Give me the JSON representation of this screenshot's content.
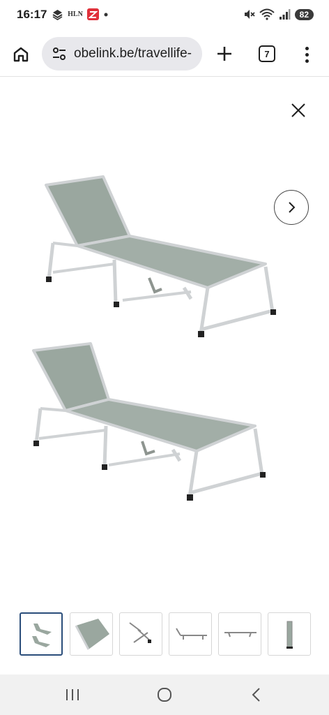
{
  "status_bar": {
    "time": "16:17",
    "notification_icons": [
      "stack-app-icon",
      "hln-icon",
      "zalando-icon",
      "dot-icon"
    ],
    "hln_label": "HLN",
    "system_icons": [
      "mute-icon",
      "wifi-icon",
      "signal-icon"
    ],
    "battery": "82"
  },
  "browser": {
    "url": "obelink.be/travellife-",
    "tab_count": "7"
  },
  "gallery": {
    "image_alt": "two-sun-loungers",
    "active_thumbnail_index": 0,
    "thumbnails": [
      {
        "subject": "two loungers"
      },
      {
        "subject": "fabric close-up"
      },
      {
        "subject": "frame detail"
      },
      {
        "subject": "lounger flat side view"
      },
      {
        "subject": "lounger low side view"
      },
      {
        "subject": "folded lounger"
      }
    ]
  },
  "colors": {
    "fabric": "#9aa79f",
    "frame": "#cfd2d4",
    "feet": "#222222",
    "active_border": "#2a4d7a"
  }
}
